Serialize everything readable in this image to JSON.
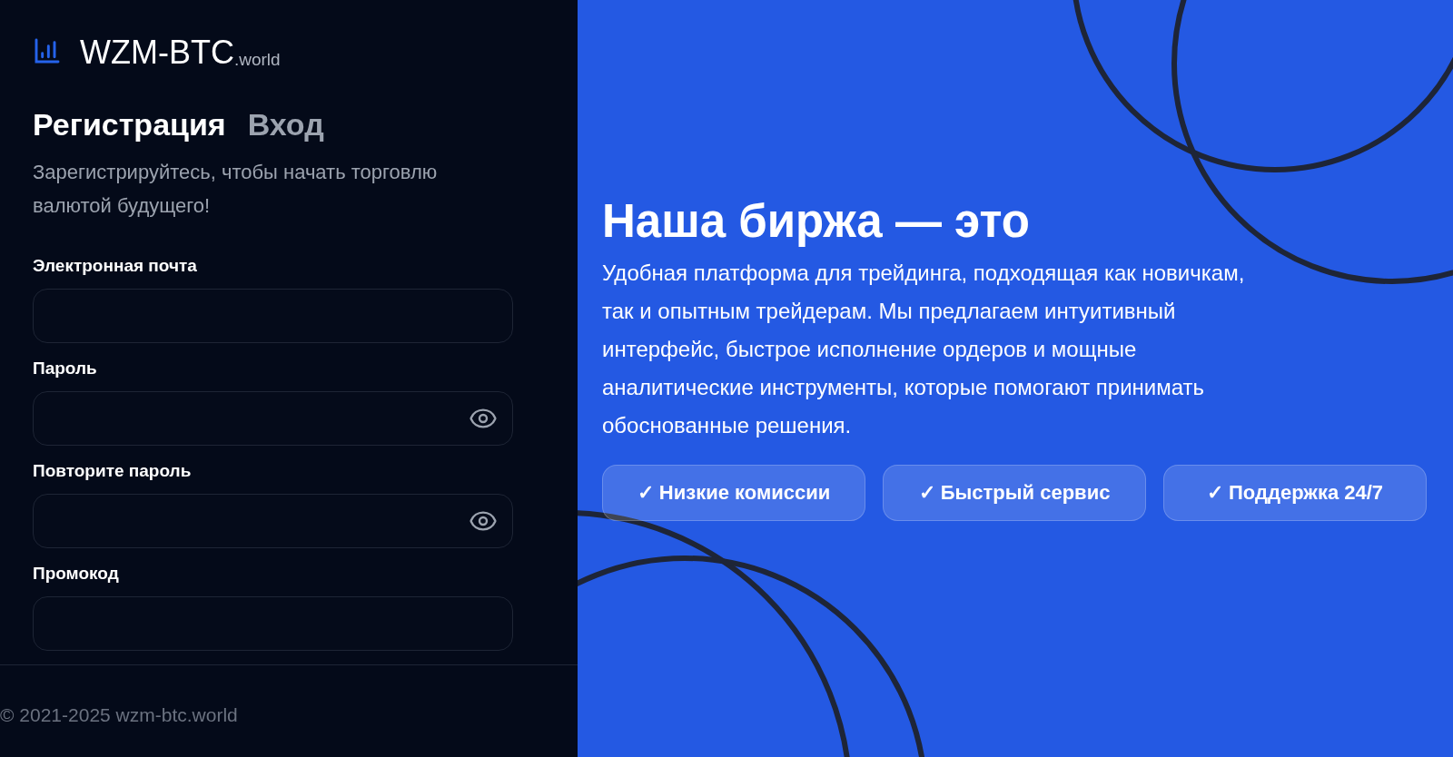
{
  "logo": {
    "name": "WZM-BTC",
    "suffix": ".world"
  },
  "tabs": [
    {
      "label": "Регистрация",
      "selected": true
    },
    {
      "label": "Вход",
      "selected": false
    }
  ],
  "subtitle": "Зарегистрируйтесь, чтобы начать торговлю валютой будущего!",
  "fields": [
    {
      "label": "Электронная почта",
      "kind": "text"
    },
    {
      "label": "Пароль",
      "kind": "password"
    },
    {
      "label": "Повторите пароль",
      "kind": "password"
    },
    {
      "label": "Промокод",
      "kind": "text"
    }
  ],
  "footer": "© 2021-2025 wzm-btc.world",
  "promo": {
    "heading": "Наша биржа — это",
    "text": "Удобная платформа для трейдинга, подходящая как новичкам, так и опытным трейдерам. Мы предлагаем интуитивный интерфейс, быстрое исполнение ордеров и мощные аналитические инструменты, которые помогают принимать обоснованные решения.",
    "badges": [
      "✓ Низкие комиссии",
      "✓ Быстрый сервис",
      "✓ Поддержка 24/7"
    ]
  }
}
